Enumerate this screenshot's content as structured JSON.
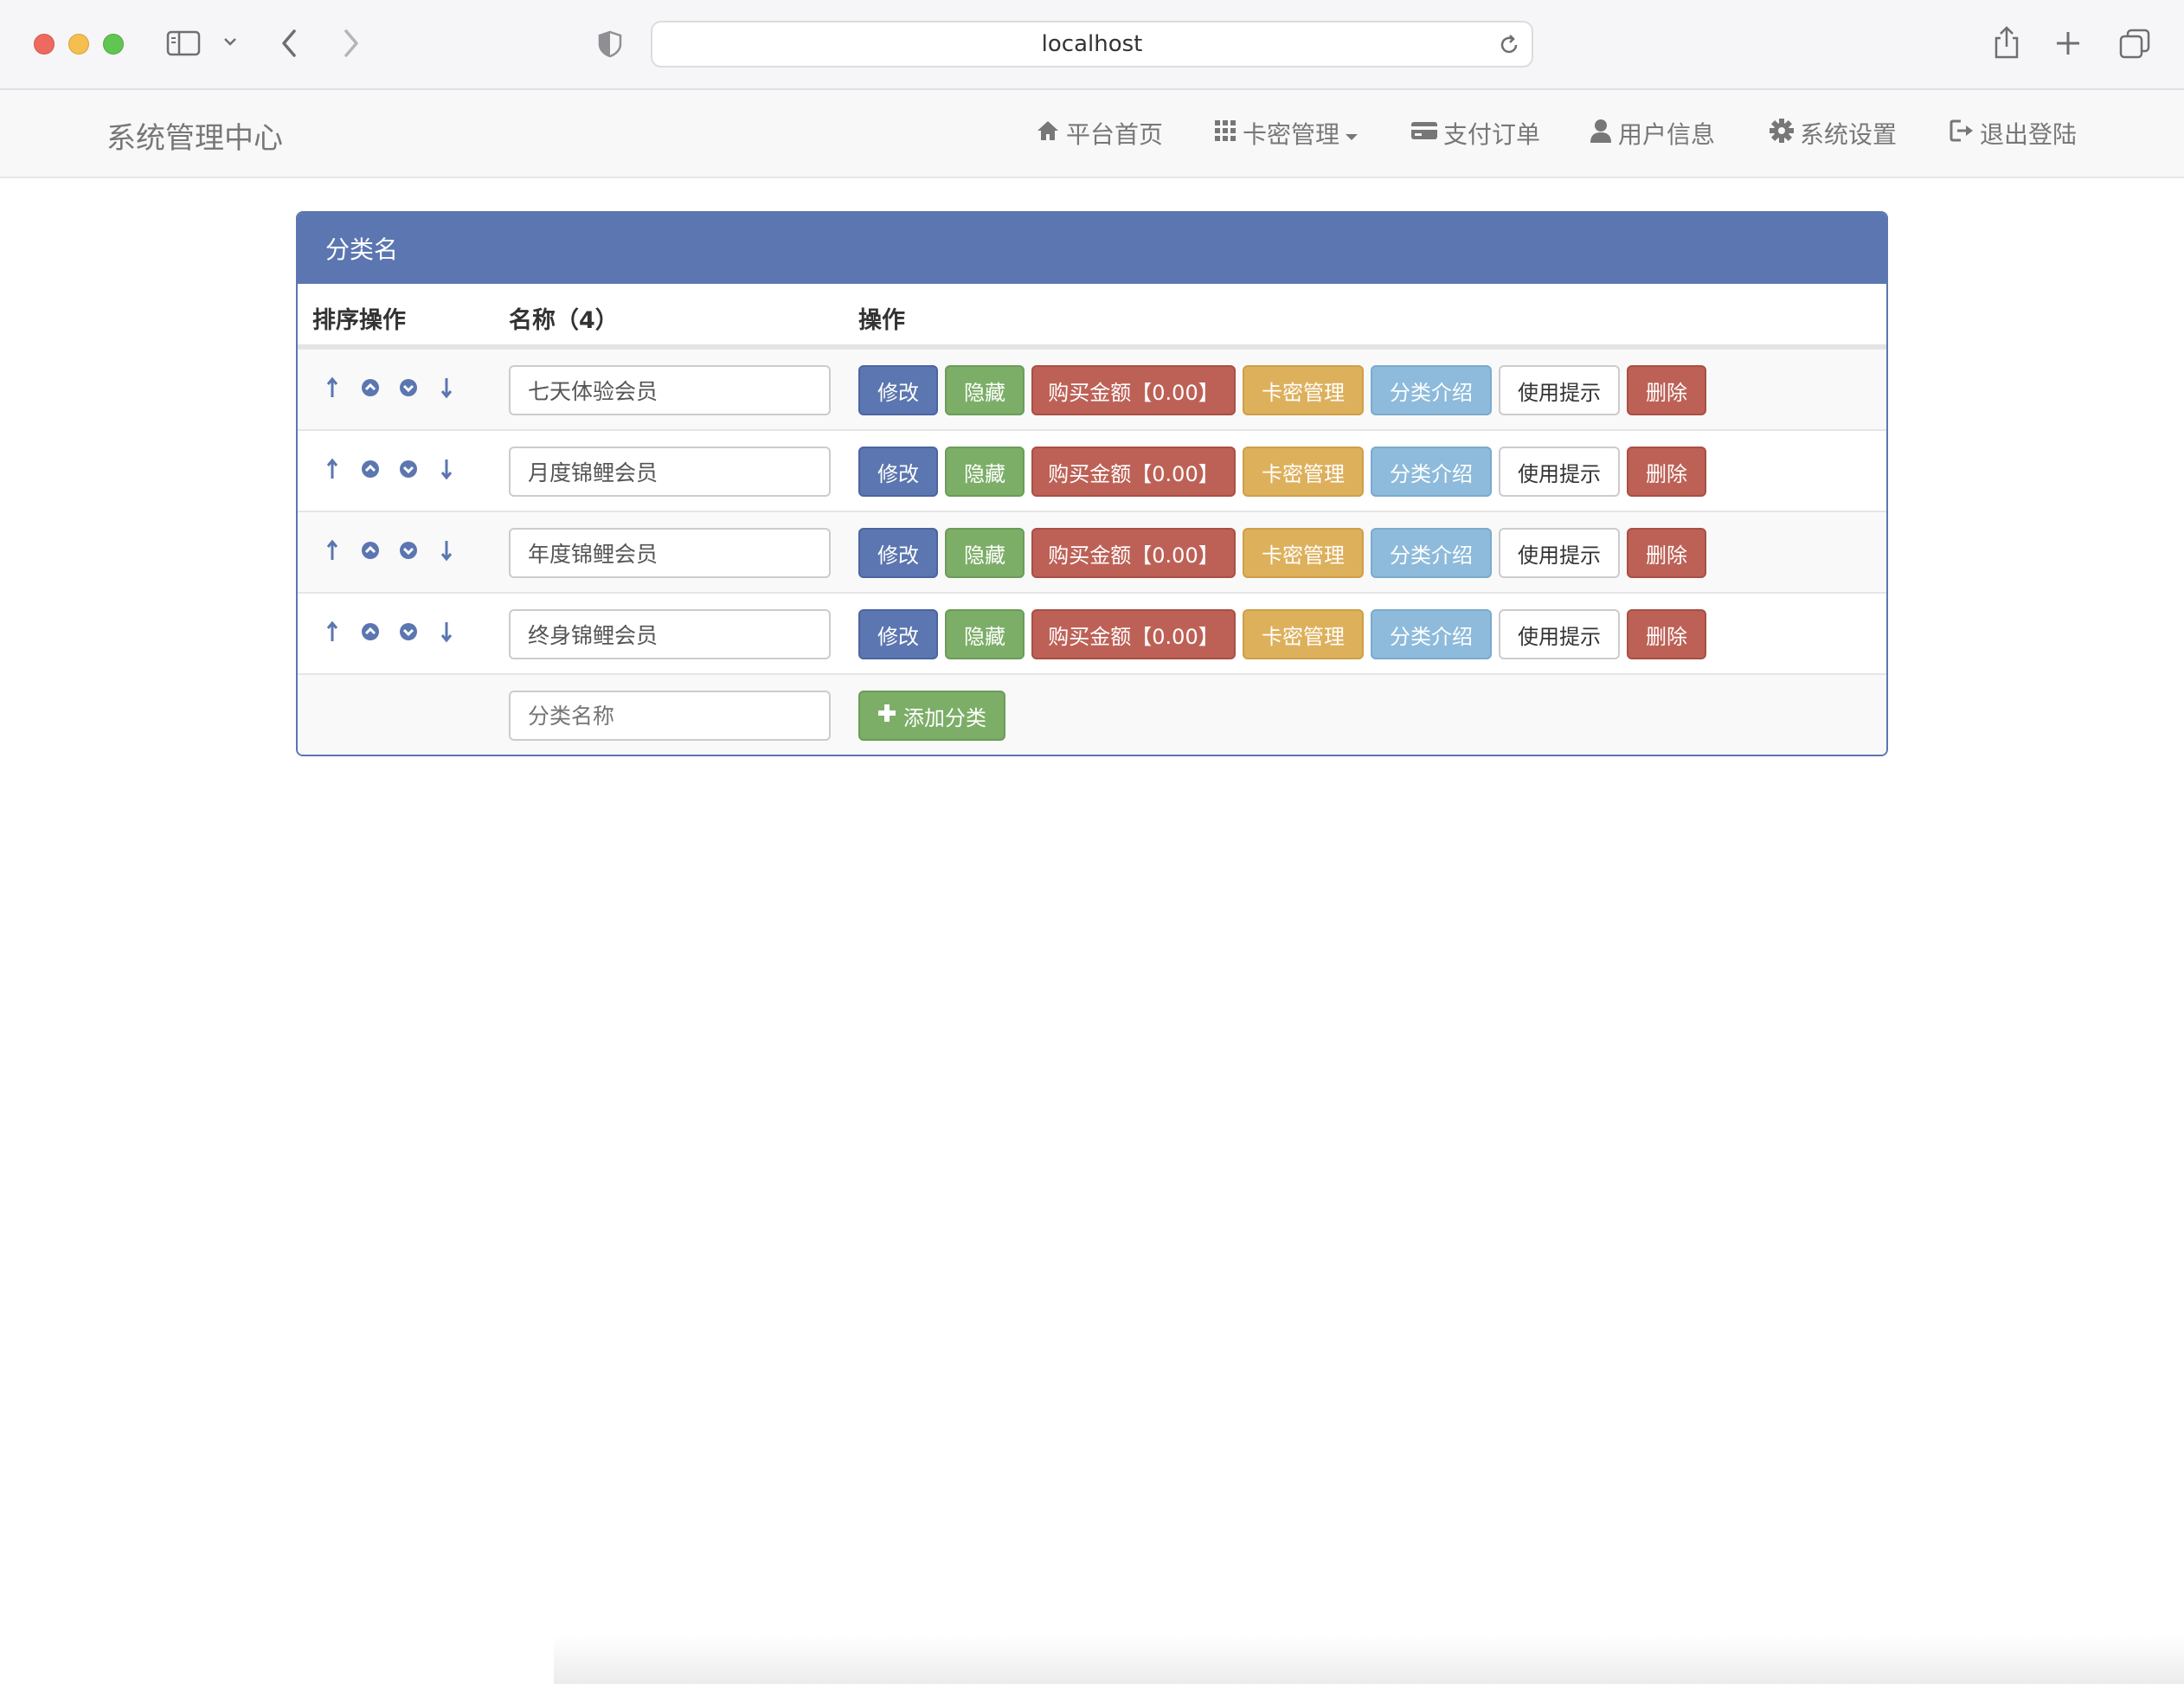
{
  "browser": {
    "url": "localhost"
  },
  "navbar": {
    "brand": "系统管理中心",
    "items": [
      {
        "label": "平台首页",
        "icon": "home-icon"
      },
      {
        "label": "卡密管理",
        "icon": "grid-icon",
        "dropdown": true
      },
      {
        "label": "支付订单",
        "icon": "credit-card-icon"
      },
      {
        "label": "用户信息",
        "icon": "user-icon"
      },
      {
        "label": "系统设置",
        "icon": "gear-icon"
      },
      {
        "label": "退出登陆",
        "icon": "logout-icon"
      }
    ]
  },
  "panel": {
    "title": "分类名",
    "columns": {
      "sort": "排序操作",
      "name": "名称（4）",
      "actions": "操作"
    },
    "rows": [
      {
        "name": "七天体验会员"
      },
      {
        "name": "月度锦鲤会员"
      },
      {
        "name": "年度锦鲤会员"
      },
      {
        "name": "终身锦鲤会员"
      }
    ],
    "row_buttons": {
      "edit": "修改",
      "hide": "隐藏",
      "price": "购买金额【0.00】",
      "cards": "卡密管理",
      "intro": "分类介绍",
      "tips": "使用提示",
      "delete": "删除"
    },
    "add_row": {
      "placeholder": "分类名称",
      "button": "添加分类"
    }
  },
  "colors": {
    "primary": "#5b76b0",
    "success": "#7cae67",
    "danger": "#bd6156",
    "warning": "#ddb05c",
    "info": "#8ebbdb"
  }
}
